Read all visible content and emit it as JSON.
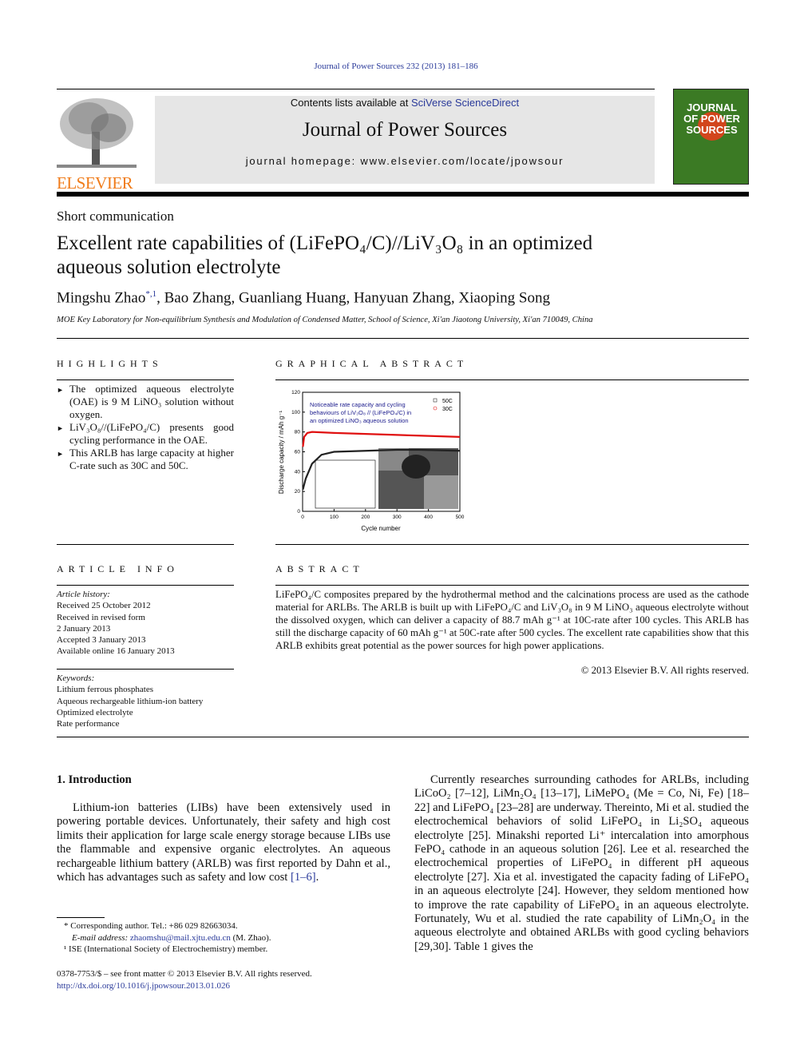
{
  "running_header": "Journal of Power Sources 232 (2013) 181–186",
  "masthead": {
    "publisher_logo": "ELSEVIER",
    "contents_prefix": "Contents lists available at ",
    "contents_link": "SciVerse ScienceDirect",
    "journal_title": "Journal of Power Sources",
    "homepage": "journal homepage: www.elsevier.com/locate/jpowsour",
    "cover_text": "JOURNAL OF POWER SOURCES",
    "brand_color": "#f07c1a",
    "cover_color": "#3b7a24"
  },
  "article_type": "Short communication",
  "title_line1": "Excellent rate capabilities of (LiFePO₄/C)//LiV₃O₈ in an optimized",
  "title_line2": "aqueous solution electrolyte",
  "authors": {
    "first": "Mingshu Zhao",
    "first_marks": "*,1",
    "rest": ", Bao Zhang, Guanliang Huang, Hanyuan Zhang, Xiaoping Song"
  },
  "affiliation": "MOE Key Laboratory for Non-equilibrium Synthesis and Modulation of Condensed Matter, School of Science, Xi'an Jiaotong University, Xi'an 710049, China",
  "highlights": {
    "heading": "HIGHLIGHTS",
    "items": [
      "The optimized aqueous electrolyte (OAE) is 9 M LiNO₃ solution without oxygen.",
      "LiV₃O₈//(LiFePO₄/C) presents good cycling performance in the OAE.",
      "This ARLB has large capacity at higher C-rate such as 30C and 50C."
    ]
  },
  "graphical_abstract": {
    "heading": "GRAPHICAL ABSTRACT",
    "annotation": [
      "Noticeable rate capacity and cycling",
      "behaviours of LiV₃O₈ // (LiFePO₄/C) in",
      "an optimized LiNO₃ aqueous solution"
    ],
    "xlabel": "Cycle number",
    "ylabel": "Discharge capacity / mAh g⁻¹",
    "xticks": [
      "0",
      "100",
      "200",
      "300",
      "400",
      "500"
    ],
    "yticks": [
      "0",
      "20",
      "40",
      "60",
      "80",
      "100",
      "120"
    ],
    "xlim": [
      0,
      500
    ],
    "ylim": [
      0,
      120
    ],
    "series": [
      {
        "name": "50C",
        "color": "#222222",
        "points": [
          [
            1,
            22
          ],
          [
            10,
            33
          ],
          [
            30,
            48
          ],
          [
            60,
            57
          ],
          [
            100,
            60
          ],
          [
            200,
            61
          ],
          [
            300,
            62
          ],
          [
            370,
            62
          ],
          [
            500,
            61
          ]
        ]
      },
      {
        "name": "30C",
        "color": "#e01010",
        "points": [
          [
            1,
            65
          ],
          [
            5,
            75
          ],
          [
            15,
            79
          ],
          [
            30,
            80
          ],
          [
            100,
            79
          ],
          [
            200,
            78
          ],
          [
            300,
            77
          ],
          [
            400,
            76
          ],
          [
            500,
            75
          ]
        ]
      }
    ]
  },
  "article_info": {
    "heading": "ARTICLE INFO",
    "history_label": "Article history:",
    "history": [
      "Received 25 October 2012",
      "Received in revised form",
      "2 January 2013",
      "Accepted 3 January 2013",
      "Available online 16 January 2013"
    ],
    "keywords_label": "Keywords:",
    "keywords": [
      "Lithium ferrous phosphates",
      "Aqueous rechargeable lithium-ion battery",
      "Optimized electrolyte",
      "Rate performance"
    ]
  },
  "abstract": {
    "heading": "ABSTRACT",
    "text": "LiFePO₄/C composites prepared by the hydrothermal method and the calcinations process are used as the cathode material for ARLBs. The ARLB is built up with LiFePO₄/C and LiV₃O₈ in 9 M LiNO₃ aqueous electrolyte without the dissolved oxygen, which can deliver a capacity of 88.7 mAh g⁻¹ at 10C-rate after 100 cycles. This ARLB has still the discharge capacity of 60 mAh g⁻¹ at 50C-rate after 500 cycles. The excellent rate capabilities show that this ARLB exhibits great potential as the power sources for high power applications.",
    "copyright": "© 2013 Elsevier B.V. All rights reserved."
  },
  "intro": {
    "heading": "1.  Introduction",
    "para1": "Lithium-ion batteries (LIBs) have been extensively used in powering portable devices. Unfortunately, their safety and high cost limits their application for large scale energy storage because LIBs use the flammable and expensive organic electrolytes. An aqueous rechargeable lithium battery (ARLB) was first reported by Dahn et al., which has advantages such as safety and low cost ",
    "para1_ref": "[1–6]",
    "para2": "Currently researches surrounding cathodes for ARLBs, including LiCoO₂ [7–12], LiMn₂O₄ [13–17], LiMePO₄ (Me = Co, Ni, Fe) [18–22] and LiFePO₄ [23–28] are underway. Thereinto, Mi et al. studied the electrochemical behaviors of solid LiFePO₄ in Li₂SO₄ aqueous electrolyte [25]. Minakshi reported Li⁺ intercalation into amorphous FePO₄ cathode in an aqueous solution [26]. Lee et al. researched the electrochemical properties of LiFePO₄ in different pH aqueous electrolyte [27]. Xia et al. investigated the capacity fading of LiFePO₄ in an aqueous electrolyte [24]. However, they seldom mentioned how to improve the rate capability of LiFePO₄ in an aqueous electrolyte. Fortunately, Wu et al. studied the rate capability of LiMn₂O₄ in the aqueous electrolyte and obtained ARLBs with good cycling behaviors [29,30]. Table 1 gives the"
  },
  "footnotes": {
    "corr": "* Corresponding author. Tel.: +86 029 82663034.",
    "email_label": "E-mail address: ",
    "email": "zhaomshu@mail.xjtu.edu.cn",
    "email_suffix": " (M. Zhao).",
    "note1": "¹ ISE (International Society of Electrochemistry) member."
  },
  "bottom": {
    "issn": "0378-7753/$ – see front matter © 2013 Elsevier B.V. All rights reserved.",
    "doi": "http://dx.doi.org/10.1016/j.jpowsour.2013.01.026"
  }
}
